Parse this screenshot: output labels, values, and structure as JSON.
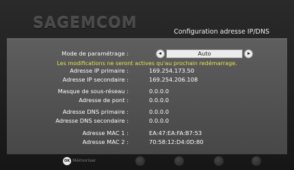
{
  "header": {
    "logo": "SAGEMCOM",
    "title": "Configuration adresse IP/DNS"
  },
  "mode": {
    "label": "Mode de paramétrage :",
    "value": "Auto"
  },
  "notice": "Les modifications ne seront actives qu'au prochain redémarrage.",
  "fields": [
    {
      "label": "Adresse IP primaire :",
      "value": "169.254.173.50"
    },
    {
      "label": "Adresse IP secondaire :",
      "value": "169.254.206.108"
    },
    {
      "label": "Masque de sous-réseau :",
      "value": "0.0.0.0"
    },
    {
      "label": "Adresse de pont :",
      "value": "0.0.0.0"
    },
    {
      "label": "Adresse DNS primaire :",
      "value": "0.0.0.0"
    },
    {
      "label": "Adresse DNS secondaire :",
      "value": "0.0.0.0"
    },
    {
      "label": "Adresse MAC 1 :",
      "value": "EA:47:EA:FA:B7:53"
    },
    {
      "label": "Adresse MAC 2 :",
      "value": "70:58:12:D4:0D:80"
    }
  ],
  "footer": {
    "ok_icon_text": "OK",
    "ok_label": "Mémoriser"
  }
}
